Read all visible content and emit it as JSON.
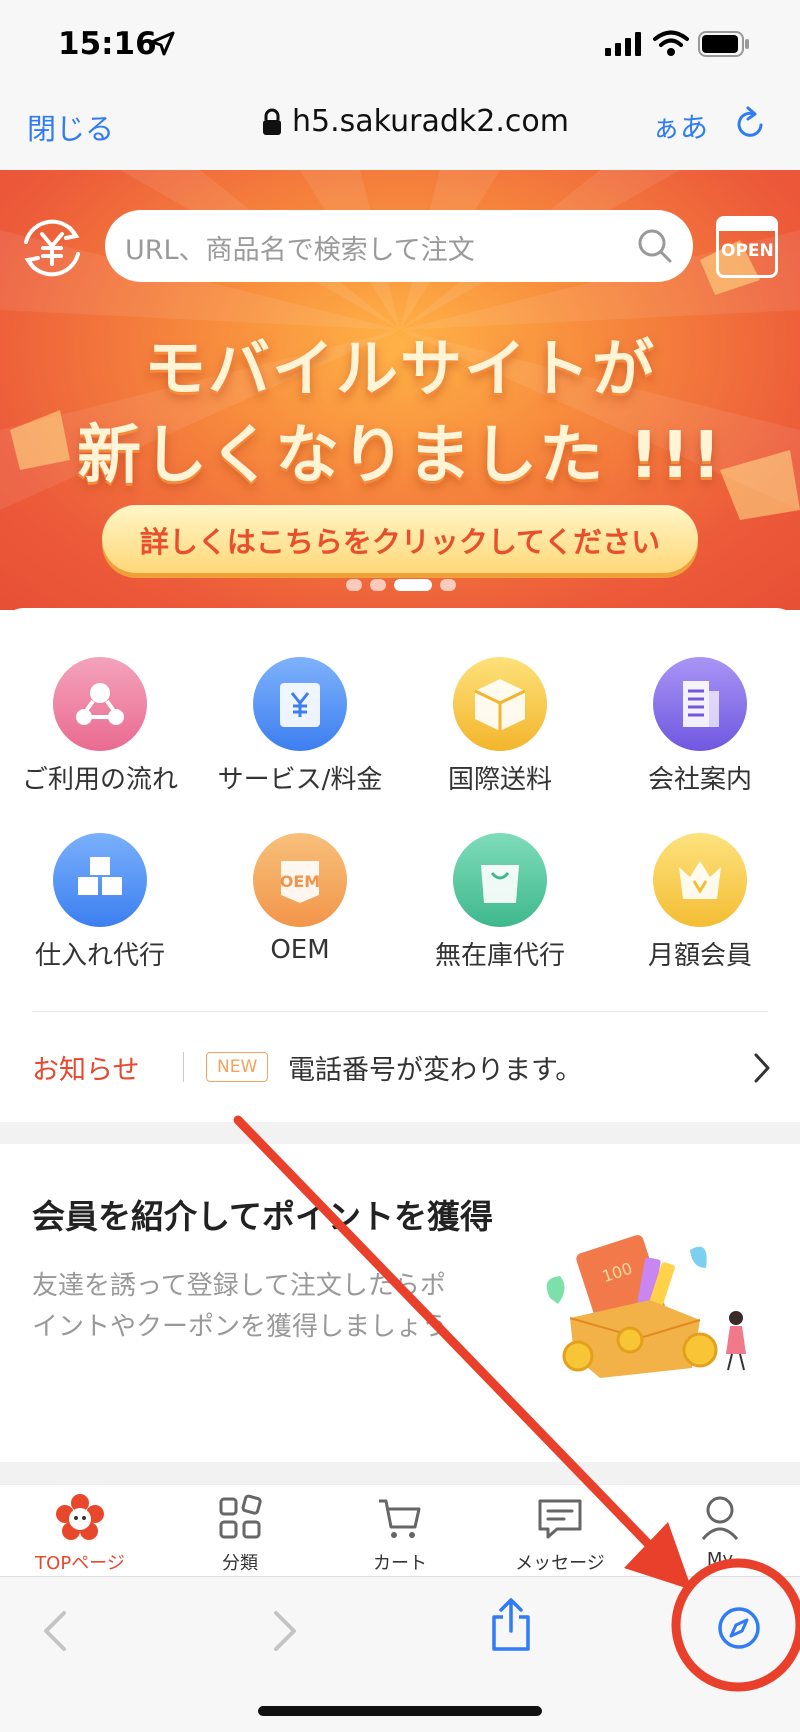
{
  "status_bar": {
    "time": "15:16"
  },
  "browser": {
    "close_label": "閉じる",
    "url": "h5.sakuradk2.com",
    "text_size_label": "ぁあ"
  },
  "banner": {
    "search_placeholder": "URL、商品名で検索して注文",
    "calendar_label": "OPEN",
    "headline_line1": "モバイルサイトが",
    "headline_line2": "新しくなりました !!!",
    "cta_label": "詳しくはこちらをクリックしてください",
    "carousel_active_index": 2,
    "carousel_count": 4
  },
  "services": [
    {
      "label": "ご利用の流れ",
      "icon": "flow-icon",
      "color": "#ee7fa0"
    },
    {
      "label": "サービス/料金",
      "icon": "yen-service-icon",
      "color": "#4f8ff2"
    },
    {
      "label": "国際送料",
      "icon": "package-icon",
      "color": "#f6c040"
    },
    {
      "label": "会社案内",
      "icon": "building-icon",
      "color": "#8a74e6"
    },
    {
      "label": "仕入れ代行",
      "icon": "boxes-icon",
      "color": "#4c8bf0"
    },
    {
      "label": "OEM",
      "icon": "oem-icon",
      "color": "#f4a555"
    },
    {
      "label": "無在庫代行",
      "icon": "bag-icon",
      "color": "#5ccaa4"
    },
    {
      "label": "月額会員",
      "icon": "crown-icon",
      "color": "#f7c94a"
    }
  ],
  "notice": {
    "label": "お知らせ",
    "badge": "NEW",
    "text": "電話番号が変わります。"
  },
  "referral": {
    "title": "会員を紹介してポイントを獲得",
    "description": "友達を誘って登録して注文したらポイントやクーポンを獲得しましょう"
  },
  "tabs": [
    {
      "label": "TOPページ",
      "icon": "sakura-logo-icon",
      "active": true
    },
    {
      "label": "分類",
      "icon": "grid-icon",
      "active": false
    },
    {
      "label": "カート",
      "icon": "cart-icon",
      "active": false
    },
    {
      "label": "メッセージ",
      "icon": "message-icon",
      "active": false
    },
    {
      "label": "My",
      "icon": "profile-icon",
      "active": false
    }
  ],
  "colors": {
    "accent_red": "#e8472c",
    "ios_blue": "#2f7cf6",
    "annotation_red": "#e8402a"
  }
}
